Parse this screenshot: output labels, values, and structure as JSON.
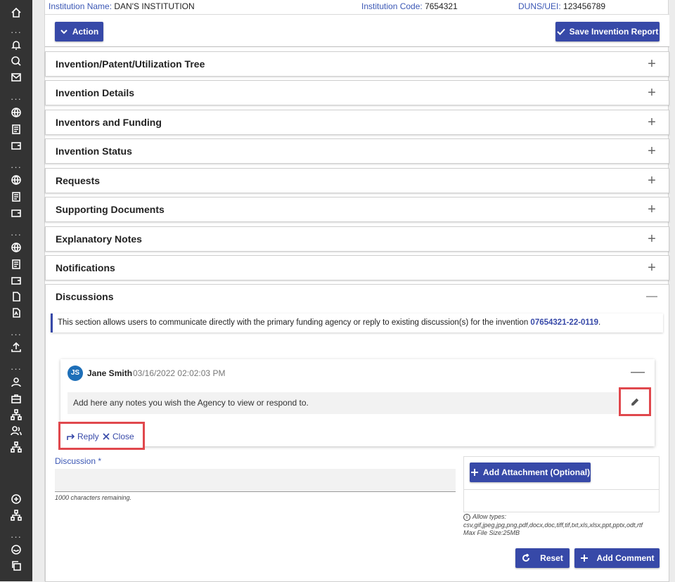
{
  "info": {
    "institution_label": "Institution Name:",
    "institution_value": "DAN'S INSTITUTION",
    "code_label": "Institution Code:",
    "code_value": "7654321",
    "duns_label": "DUNS/UEI:",
    "duns_value": "123456789"
  },
  "toolbar": {
    "action_label": "Action",
    "save_label": "Save Invention Report"
  },
  "sections": [
    {
      "title": "Invention/Patent/Utilization Tree",
      "state": "+"
    },
    {
      "title": "Invention Details",
      "state": "+"
    },
    {
      "title": "Inventors and Funding",
      "state": "+"
    },
    {
      "title": "Invention Status",
      "state": "+"
    },
    {
      "title": "Requests",
      "state": "+"
    },
    {
      "title": "Supporting Documents",
      "state": "+"
    },
    {
      "title": "Explanatory Notes",
      "state": "+"
    },
    {
      "title": "Notifications",
      "state": "+"
    },
    {
      "title": "Discussions",
      "state": "—"
    }
  ],
  "discussions": {
    "notice_text": "This section allows users to communicate directly with the primary funding agency or reply to existing discussion(s) for the invention ",
    "invention_id": "07654321-22-0119",
    "notice_end": ".",
    "comment": {
      "initials": "JS",
      "author": "Jane Smith",
      "timestamp": "03/16/2022 02:02:03 PM",
      "body": "Add here any notes you wish the Agency to view or respond to.",
      "collapse": "—"
    },
    "reply_label": "Reply",
    "close_label": "Close",
    "field_label": "Discussion *",
    "field_value": "",
    "remaining": "1000 characters remaining.",
    "attach_label": "Add Attachment (Optional)",
    "allow_types_label": "Allow types:",
    "allow_types": "csv,gif,jpeg,jpg,png,pdf,docx,doc,tiff,tif,txt,xls,xlsx,ppt,pptx,odt,rtf",
    "max_size": "Max File Size:25MB",
    "reset_label": "Reset",
    "add_comment_label": "Add Comment"
  },
  "colors": {
    "accent": "#3749a8",
    "sidebar": "#333333",
    "highlight": "#e0484d"
  }
}
